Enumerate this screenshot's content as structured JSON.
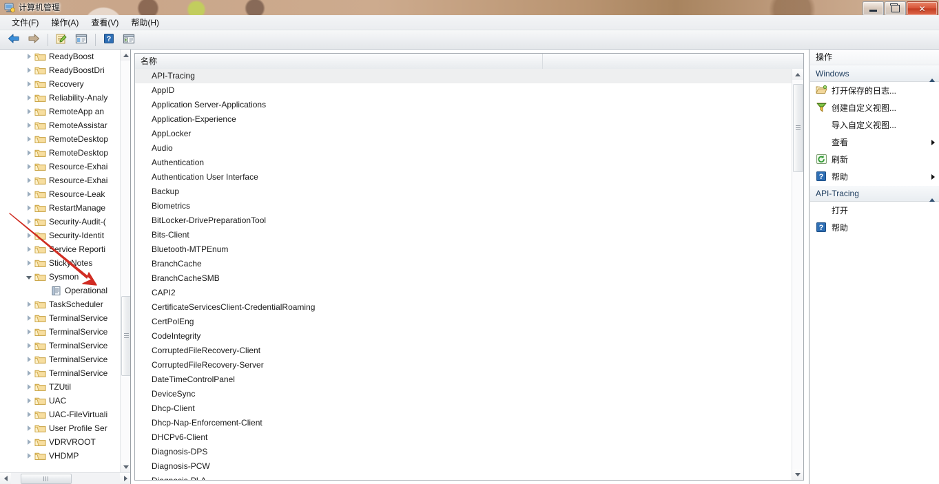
{
  "window": {
    "title": "计算机管理",
    "icon": "computer-management-icon",
    "buttons": {
      "minimize": "最小化",
      "maximize": "最大化",
      "close": "关闭"
    }
  },
  "menu": {
    "items": [
      {
        "label": "文件(F)",
        "name": "menu-file"
      },
      {
        "label": "操作(A)",
        "name": "menu-action"
      },
      {
        "label": "查看(V)",
        "name": "menu-view"
      },
      {
        "label": "帮助(H)",
        "name": "menu-help"
      }
    ]
  },
  "toolbar": {
    "buttons": [
      {
        "icon": "back-arrow-icon",
        "name": "toolbar-back"
      },
      {
        "icon": "forward-arrow-icon",
        "name": "toolbar-forward"
      },
      {
        "icon": "properties-icon",
        "name": "toolbar-properties"
      },
      {
        "icon": "show-hide-console-tree-icon",
        "name": "toolbar-console-tree"
      },
      {
        "icon": "help-icon",
        "name": "toolbar-help"
      },
      {
        "icon": "show-hide-action-pane-icon",
        "name": "toolbar-action-pane"
      }
    ]
  },
  "tree": {
    "items": [
      {
        "label": "ReadyBoost",
        "expander": "closed",
        "icon": "folder-icon",
        "indent": 0
      },
      {
        "label": "ReadyBoostDri",
        "expander": "closed",
        "icon": "folder-icon",
        "indent": 0
      },
      {
        "label": "Recovery",
        "expander": "closed",
        "icon": "folder-icon",
        "indent": 0
      },
      {
        "label": "Reliability-Analy",
        "expander": "closed",
        "icon": "folder-icon",
        "indent": 0
      },
      {
        "label": "RemoteApp an",
        "expander": "closed",
        "icon": "folder-icon",
        "indent": 0
      },
      {
        "label": "RemoteAssistar",
        "expander": "closed",
        "icon": "folder-icon",
        "indent": 0
      },
      {
        "label": "RemoteDesktop",
        "expander": "closed",
        "icon": "folder-icon",
        "indent": 0
      },
      {
        "label": "RemoteDesktop",
        "expander": "closed",
        "icon": "folder-icon",
        "indent": 0
      },
      {
        "label": "Resource-Exhai",
        "expander": "closed",
        "icon": "folder-icon",
        "indent": 0
      },
      {
        "label": "Resource-Exhai",
        "expander": "closed",
        "icon": "folder-icon",
        "indent": 0
      },
      {
        "label": "Resource-Leak",
        "expander": "closed",
        "icon": "folder-icon",
        "indent": 0
      },
      {
        "label": "RestartManage",
        "expander": "closed",
        "icon": "folder-icon",
        "indent": 0
      },
      {
        "label": "Security-Audit-(",
        "expander": "closed",
        "icon": "folder-icon",
        "indent": 0
      },
      {
        "label": "Security-Identit",
        "expander": "closed",
        "icon": "folder-icon",
        "indent": 0
      },
      {
        "label": "Service Reporti",
        "expander": "closed",
        "icon": "folder-icon",
        "indent": 0
      },
      {
        "label": "StickyNotes",
        "expander": "closed",
        "icon": "folder-icon",
        "indent": 0
      },
      {
        "label": "Sysmon",
        "expander": "open",
        "icon": "folder-icon",
        "indent": 0
      },
      {
        "label": "Operational",
        "expander": "none",
        "icon": "log-icon",
        "indent": 1
      },
      {
        "label": "TaskScheduler",
        "expander": "closed",
        "icon": "folder-icon",
        "indent": 0
      },
      {
        "label": "TerminalService",
        "expander": "closed",
        "icon": "folder-icon",
        "indent": 0
      },
      {
        "label": "TerminalService",
        "expander": "closed",
        "icon": "folder-icon",
        "indent": 0
      },
      {
        "label": "TerminalService",
        "expander": "closed",
        "icon": "folder-icon",
        "indent": 0
      },
      {
        "label": "TerminalService",
        "expander": "closed",
        "icon": "folder-icon",
        "indent": 0
      },
      {
        "label": "TerminalService",
        "expander": "closed",
        "icon": "folder-icon",
        "indent": 0
      },
      {
        "label": "TZUtil",
        "expander": "closed",
        "icon": "folder-icon",
        "indent": 0
      },
      {
        "label": "UAC",
        "expander": "closed",
        "icon": "folder-icon",
        "indent": 0
      },
      {
        "label": "UAC-FileVirtuali",
        "expander": "closed",
        "icon": "folder-icon",
        "indent": 0
      },
      {
        "label": "User Profile Ser",
        "expander": "closed",
        "icon": "folder-icon",
        "indent": 0
      },
      {
        "label": "VDRVROOT",
        "expander": "closed",
        "icon": "folder-icon",
        "indent": 0
      },
      {
        "label": "VHDMP",
        "expander": "closed",
        "icon": "folder-icon",
        "indent": 0
      }
    ]
  },
  "list": {
    "columns": [
      "名称",
      ""
    ],
    "selected": "API-Tracing",
    "rows": [
      "API-Tracing",
      "AppID",
      "Application Server-Applications",
      "Application-Experience",
      "AppLocker",
      "Audio",
      "Authentication",
      "Authentication User Interface",
      "Backup",
      "Biometrics",
      "BitLocker-DrivePreparationTool",
      "Bits-Client",
      "Bluetooth-MTPEnum",
      "BranchCache",
      "BranchCacheSMB",
      "CAPI2",
      "CertificateServicesClient-CredentialRoaming",
      "CertPolEng",
      "CodeIntegrity",
      "CorruptedFileRecovery-Client",
      "CorruptedFileRecovery-Server",
      "DateTimeControlPanel",
      "DeviceSync",
      "Dhcp-Client",
      "Dhcp-Nap-Enforcement-Client",
      "DHCPv6-Client",
      "Diagnosis-DPS",
      "Diagnosis-PCW",
      "Diagnosis-PLA"
    ]
  },
  "actions": {
    "title": "操作",
    "sections": [
      {
        "title": "Windows",
        "name": "actions-section-windows",
        "items": [
          {
            "label": "打开保存的日志...",
            "icon": "open-folder-icon",
            "submenu": false
          },
          {
            "label": "创建自定义视图...",
            "icon": "filter-icon",
            "submenu": false
          },
          {
            "label": "导入自定义视图...",
            "icon": "none",
            "submenu": false
          },
          {
            "label": "查看",
            "icon": "none",
            "submenu": true
          },
          {
            "label": "刷新",
            "icon": "refresh-icon",
            "submenu": false
          },
          {
            "label": "帮助",
            "icon": "help-icon",
            "submenu": true
          }
        ]
      },
      {
        "title": "API-Tracing",
        "name": "actions-section-api-tracing",
        "items": [
          {
            "label": "打开",
            "icon": "none",
            "submenu": false
          },
          {
            "label": "帮助",
            "icon": "help-icon",
            "submenu": false
          }
        ]
      }
    ]
  },
  "annotation": {
    "type": "red-arrow",
    "points_at": "Sysmon",
    "color": "#e03030"
  }
}
